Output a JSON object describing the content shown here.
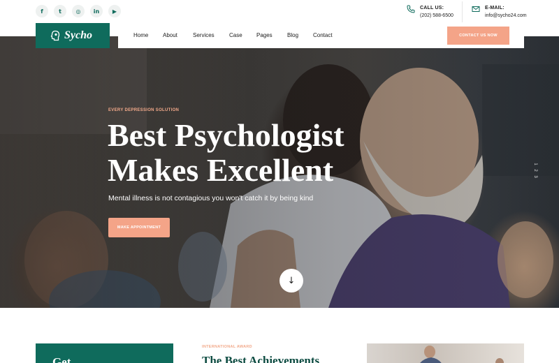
{
  "brand": {
    "name": "Sycho",
    "color": "#0f6b5c",
    "accent": "#f4a488"
  },
  "socials": [
    {
      "icon": "facebook-icon",
      "glyph": "f"
    },
    {
      "icon": "twitter-icon",
      "glyph": "t"
    },
    {
      "icon": "instagram-icon",
      "glyph": "◎"
    },
    {
      "icon": "linkedin-icon",
      "glyph": "in"
    },
    {
      "icon": "youtube-icon",
      "glyph": "▶"
    }
  ],
  "contact": {
    "call_label": "CALL US:",
    "call_value": "(202) 588-6500",
    "email_label": "E-MAIL:",
    "email_value": "info@sycho24.com"
  },
  "nav": {
    "items": [
      "Home",
      "About",
      "Services",
      "Case",
      "Pages",
      "Blog",
      "Contact"
    ],
    "cta": "CONTACT US NOW"
  },
  "hero": {
    "eyebrow": "EVERY DEPRESSION SOLUTION",
    "title_line1": "Best Psychologist",
    "title_line2": "Makes Excellent",
    "subtitle": "Mental illness is not contagious you won't catch it by being kind",
    "button": "MAKE APPOINTMENT",
    "slides": [
      "1",
      "2",
      "3"
    ],
    "scroll_glyph": "↓"
  },
  "below": {
    "card_text": "Get",
    "award_eyebrow": "INTERNATIONAL AWARD",
    "award_title": "The Best Achievements"
  }
}
